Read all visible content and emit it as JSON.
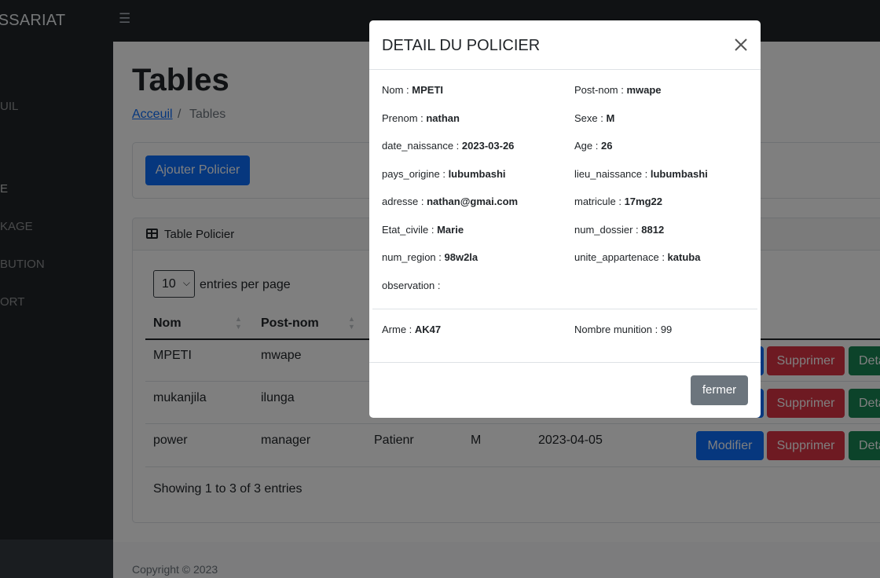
{
  "app": {
    "brand": "ISSARIAT"
  },
  "sidebar": {
    "items": [
      "UIL",
      "E",
      "KAGE",
      "BUTION",
      "ORT"
    ]
  },
  "page": {
    "title": "Tables",
    "breadcrumb": {
      "home": "Acceuil",
      "separator": "/",
      "current": "Tables"
    },
    "add_button": "Ajouter Policier",
    "card_title": "Table Policier",
    "entries_value": "10",
    "entries_label": "entries per page",
    "showing": "Showing 1 to 3 of 3 entries",
    "copyright": "Copyright © 2023"
  },
  "table": {
    "headers": [
      "Nom",
      "Post-nom"
    ],
    "rows": [
      {
        "nom": "MPETI",
        "postnom": "mwape",
        "prenom": "",
        "sexe": "",
        "date": ""
      },
      {
        "nom": "mukanjila",
        "postnom": "ilunga",
        "prenom": "",
        "sexe": "",
        "date": ""
      },
      {
        "nom": "power",
        "postnom": "manager",
        "prenom": "Patienr",
        "sexe": "M",
        "date": "2023-04-05"
      }
    ],
    "actions": {
      "modify": "Modifier",
      "delete": "Supprimer",
      "detail": "Deta"
    }
  },
  "modal": {
    "title": "DETAIL DU POLICIER",
    "fields": {
      "nom": {
        "label": "Nom : ",
        "value": "MPETI"
      },
      "postnom": {
        "label": "Post-nom : ",
        "value": "mwape"
      },
      "prenom": {
        "label": "Prenom : ",
        "value": "nathan"
      },
      "sexe": {
        "label": "Sexe : ",
        "value": "M"
      },
      "date_naissance": {
        "label": "date_naissance : ",
        "value": "2023-03-26"
      },
      "age": {
        "label": "Age : ",
        "value": "26"
      },
      "pays_origine": {
        "label": "pays_origine : ",
        "value": "lubumbashi"
      },
      "lieu_naissance": {
        "label": "lieu_naissance : ",
        "value": "lubumbashi"
      },
      "adresse": {
        "label": "adresse : ",
        "value": "nathan@gmai.com"
      },
      "matricule": {
        "label": "matricule : ",
        "value": "17mg22"
      },
      "etat_civile": {
        "label": "Etat_civile : ",
        "value": "Marie"
      },
      "num_dossier": {
        "label": "num_dossier : ",
        "value": "8812"
      },
      "num_region": {
        "label": "num_region : ",
        "value": "98w2la"
      },
      "unite": {
        "label": "unite_appartenace : ",
        "value": "katuba"
      },
      "observation": {
        "label": "observation : ",
        "value": ""
      },
      "arme": {
        "label": "Arme : ",
        "value": "AK47"
      },
      "munition": {
        "label": "Nombre munition : ",
        "value": "99"
      }
    },
    "close_button": "fermer"
  }
}
